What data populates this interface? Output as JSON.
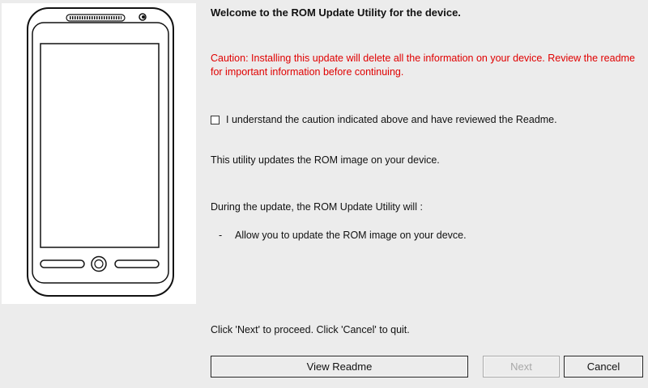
{
  "welcome": "Welcome to the ROM Update Utility for the device.",
  "caution": "Caution: Installing this update will delete all the information on your device. Review the readme for important information before continuing.",
  "acknowledgement": {
    "label": "I understand the caution indicated above and have reviewed the Readme.",
    "checked": false
  },
  "description": "This utility updates the ROM image on your device.",
  "during_update": "During the update, the ROM Update Utility will :",
  "bullets": [
    {
      "dash": "-",
      "text": "Allow you to update the ROM image on your devce."
    }
  ],
  "proceed_text": "Click 'Next' to proceed. Click 'Cancel' to quit.",
  "buttons": {
    "view_readme": "View Readme",
    "next": "Next",
    "cancel": "Cancel"
  },
  "colors": {
    "caution": "#e00000",
    "disabled_text": "#a8a8a8",
    "background": "#ececec"
  },
  "icons": {
    "device": "phone-illustration-icon"
  }
}
